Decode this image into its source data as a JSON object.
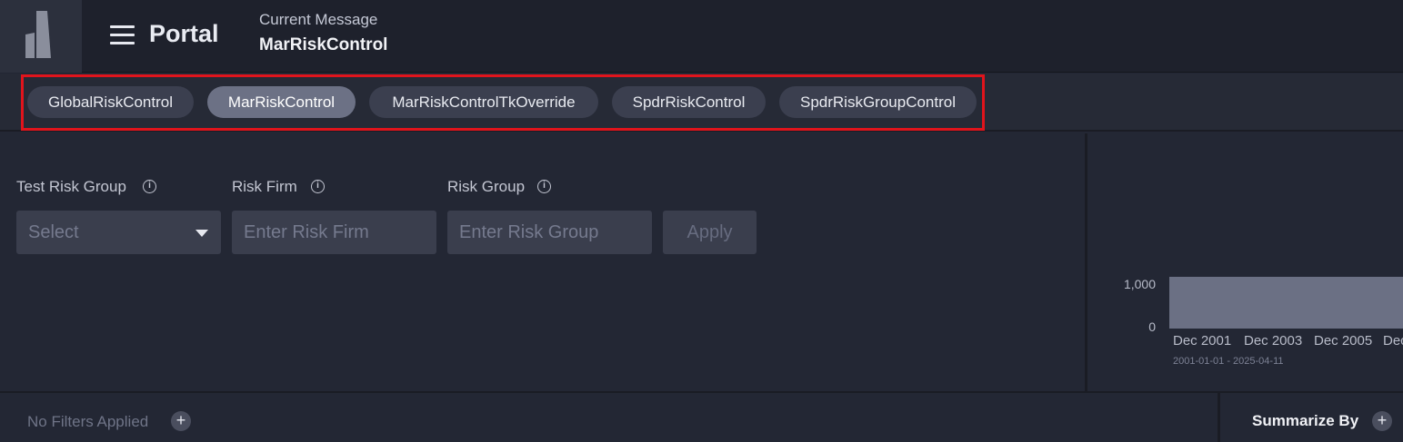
{
  "header": {
    "title": "Portal",
    "current_message_label": "Current Message",
    "current_message_value": "MarRiskControl"
  },
  "tabs": [
    {
      "label": "GlobalRiskControl",
      "active": false
    },
    {
      "label": "MarRiskControl",
      "active": true
    },
    {
      "label": "MarRiskControlTkOverride",
      "active": false
    },
    {
      "label": "SpdrRiskControl",
      "active": false
    },
    {
      "label": "SpdrRiskGroupControl",
      "active": false
    }
  ],
  "filters": {
    "test_risk_group": {
      "label": "Test Risk Group",
      "value": "Select"
    },
    "risk_firm": {
      "label": "Risk Firm",
      "placeholder": "Enter Risk Firm"
    },
    "risk_group": {
      "label": "Risk Group",
      "placeholder": "Enter Risk Group"
    },
    "apply_label": "Apply"
  },
  "chart_data": {
    "type": "bar",
    "y_ticks": [
      "1,000",
      "0"
    ],
    "x_ticks": [
      "Dec 2001",
      "Dec 2003",
      "Dec 2005",
      "Dec"
    ],
    "date_range": "2001-01-01 - 2025-04-11",
    "fill_color": "#6b7084"
  },
  "footer": {
    "no_filters": "No Filters Applied",
    "summarize_by": "Summarize By"
  },
  "colors": {
    "accent_highlight": "#e0141c",
    "active_tab": "#6c7185",
    "tab": "#3b3f4f"
  }
}
